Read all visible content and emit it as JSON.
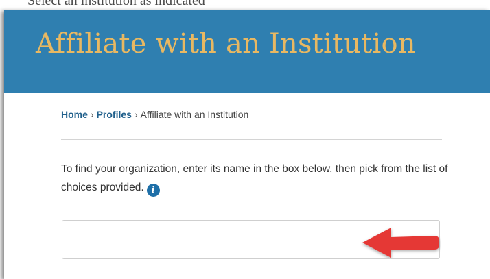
{
  "top_strip": {
    "text": "Select an institution as indicated"
  },
  "banner": {
    "title": "Affiliate with an Institution"
  },
  "breadcrumb": {
    "home": "Home",
    "separator": "›",
    "profiles": "Profiles",
    "current": "Affiliate with an Institution"
  },
  "instructions": {
    "text": "To find your organization, enter its name in the box below, then pick from the list of choices provided."
  },
  "info_icon": {
    "glyph": "i",
    "icon": "info-icon"
  },
  "search": {
    "value": "",
    "placeholder": ""
  },
  "annotation": {
    "icon": "red-arrow-icon",
    "color": "#e53935"
  },
  "colors": {
    "banner_bg": "#2f7fb0",
    "banner_text": "#e8b862",
    "link": "#1f5f8b"
  }
}
